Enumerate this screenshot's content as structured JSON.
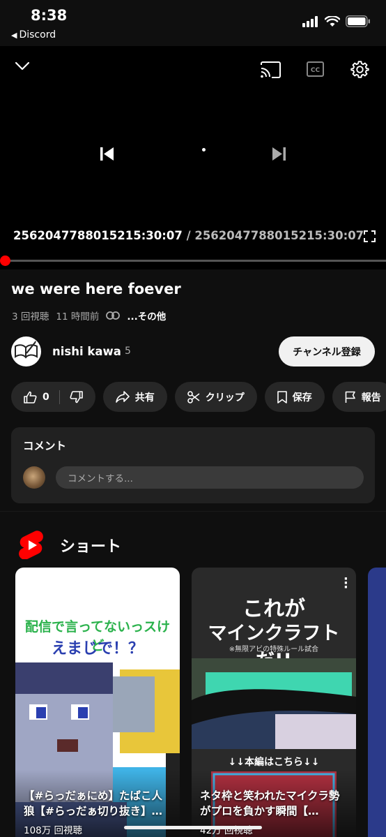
{
  "status_bar": {
    "time": "8:38",
    "back_app": "Discord"
  },
  "player": {
    "current_time": "2562047788015215:30:07",
    "separator": "/",
    "duration": "2562047788015215:30:07",
    "progress": 0,
    "accent": "#ff0000"
  },
  "video": {
    "title": "we were here foever",
    "views": "3 回視聴",
    "age": "11 時間前",
    "more": "...その他"
  },
  "channel": {
    "name": "nishi kawa",
    "subscribers": "5",
    "subscribe_label": "チャンネル登録"
  },
  "actions": {
    "likes": "0",
    "share": "共有",
    "clip": "クリップ",
    "save": "保存",
    "report": "報告"
  },
  "comments": {
    "header": "コメント",
    "placeholder": "コメントする..."
  },
  "shorts": {
    "section_title": "ショート",
    "items": [
      {
        "thumb_line1": "配信で言ってないっスけど",
        "thumb_line2": "えまじで！？",
        "title": "【#らっだぁにめ】たばこ人狼【#らっだぁ切り抜き】…",
        "views": "108万 回視聴"
      },
      {
        "thumb_line1": "これが",
        "thumb_line2": "マインクラフトだ!!",
        "thumb_line3": "※無限アビの特殊ルール試合",
        "thumb_line4": "↓↓本編はこちら↓↓",
        "title": "ネタ枠と笑われたマイクラ勢がプロを負かす瞬間【…",
        "views": "42万 回視聴"
      }
    ]
  }
}
